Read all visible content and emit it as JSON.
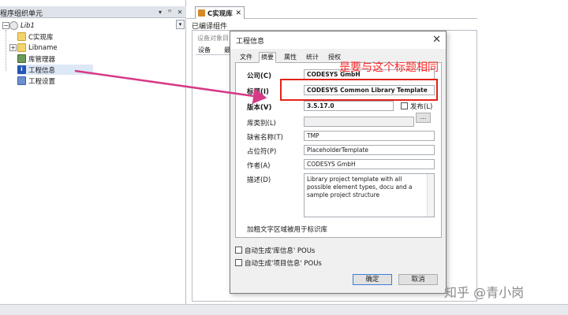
{
  "left_panel": {
    "title": "程序组织单元",
    "pin": "▾ ꟸ ✕",
    "dropdown_arrow": "▾",
    "tree": {
      "root": "Lib1",
      "items": [
        {
          "label": "C实现库",
          "icon": "folder-icon"
        },
        {
          "label": "Libname",
          "icon": "folder-icon"
        },
        {
          "label": "库管理器",
          "icon": "library-manager-icon"
        },
        {
          "label": "工程信息",
          "icon": "info-icon"
        },
        {
          "label": "工程设置",
          "icon": "settings-icon"
        }
      ]
    }
  },
  "editor": {
    "tab_label": "C实现库",
    "tab_close": "✕",
    "compiled_label": "已编译组件",
    "device_objects_label": "设备对象目",
    "inner_tabs": [
      "设备",
      "最"
    ]
  },
  "dialog": {
    "title": "工程信息",
    "close": "✕",
    "tabs": [
      "文件",
      "摘要",
      "属性",
      "统计",
      "授权"
    ],
    "selected_tab": "摘要",
    "fields": {
      "company_label": "公司(C)",
      "company_value": "CODESYS GmbH",
      "title_label": "标题(I)",
      "title_value": "CODESYS Common Library Template",
      "version_label": "版本(V)",
      "version_value": "3.5.17.0",
      "release_label": "发布(L)",
      "category_label": "库类别(L)",
      "category_value": "",
      "browse": "...",
      "default_ns_label": "缺省名称(T)",
      "default_ns_value": "TMP",
      "placeholder_label": "占位符(P)",
      "placeholder_value": "PlaceholderTemplate",
      "author_label": "作者(A)",
      "author_value": "CODESYS GmbH",
      "desc_label": "描述(D)",
      "desc_value": "Library project template with all possible element types, docu and a sample project structure"
    },
    "hint": "加粗文字区域被用于标识库",
    "auto_lib_info": "自动生成'库信息' POUs",
    "auto_proj_info": "自动生成'项目信息' POUs",
    "ok": "确定",
    "cancel": "取消"
  },
  "annotation": {
    "text": "是要与这个标题相同",
    "color": "#e2231a"
  },
  "watermark": "知乎 @青小岗"
}
